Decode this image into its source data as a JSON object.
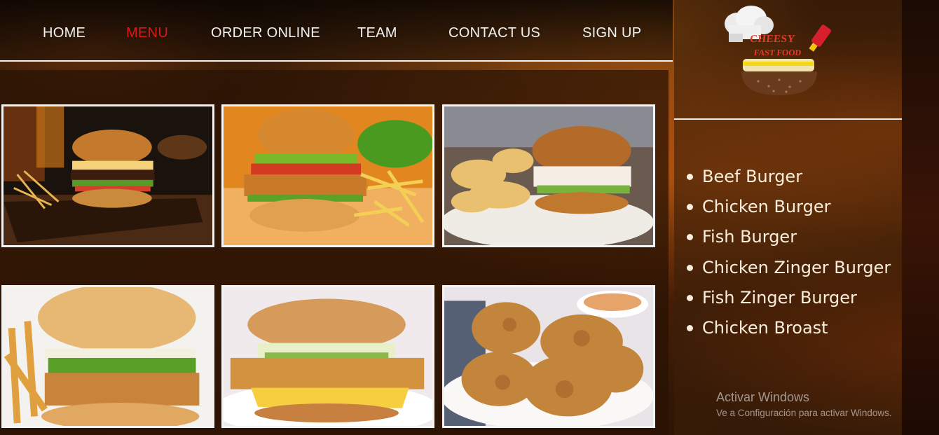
{
  "nav": {
    "items": [
      {
        "label": "HOME",
        "active": false
      },
      {
        "label": "MENU",
        "active": true
      },
      {
        "label": "ORDER ONLINE",
        "active": false
      },
      {
        "label": "TEAM",
        "active": false
      },
      {
        "label": "CONTACT US",
        "active": false
      },
      {
        "label": "SIGN UP",
        "active": false
      }
    ],
    "active_color": "#e01818",
    "text_color": "#f2f2f2"
  },
  "logo": {
    "line1": "CHEESY",
    "line2": "FAST FOOD"
  },
  "menu_list": [
    "Beef Burger",
    "Chicken Burger",
    "Fish Burger",
    "Chicken Zinger Burger",
    "Fish Zinger Burger",
    "Chicken Broast"
  ],
  "gallery": [
    {
      "icon": "beef-burger-photo"
    },
    {
      "icon": "chicken-burger-photo"
    },
    {
      "icon": "fish-burger-photo"
    },
    {
      "icon": "chicken-zinger-burger-photo"
    },
    {
      "icon": "fish-zinger-burger-photo"
    },
    {
      "icon": "chicken-broast-photo"
    }
  ],
  "watermark": {
    "title": "Activar Windows",
    "subtitle": "Ve a Configuración para activar Windows."
  }
}
